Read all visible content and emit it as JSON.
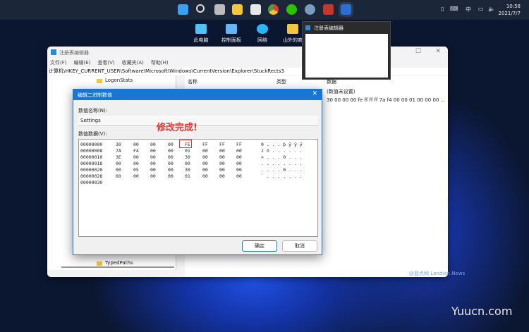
{
  "taskbar": {
    "icons": [
      "start-icon",
      "search-icon",
      "task-view-icon",
      "file-explorer-icon",
      "store-icon",
      "chrome-icon",
      "wechat-icon",
      "settings-icon",
      "app-icon",
      "regedit-icon"
    ],
    "tray": {
      "ime": "中",
      "time": "10:58",
      "date": "2021/7/7"
    }
  },
  "desktop": [
    {
      "label": "此电脑"
    },
    {
      "label": "控制面板"
    },
    {
      "label": "网络"
    },
    {
      "label": "山外的商"
    }
  ],
  "thumbnail": {
    "title": "注册表编辑器"
  },
  "window": {
    "title": "注册表编辑器",
    "menu": [
      "文件(F)",
      "编辑(E)",
      "查看(V)",
      "收藏夹(A)",
      "帮助(H)"
    ],
    "address": "计算机\\HKEY_CURRENT_USER\\Software\\Microsoft\\Windows\\CurrentVersion\\Explorer\\StuckRects3",
    "tree": [
      "LogonStats",
      "TypedPaths"
    ],
    "columns": [
      "名称",
      "类型",
      "数据"
    ],
    "values": [
      "(数值未设置)",
      "30 00 00 00 fe ff ff ff 7a f4 00 00 01 00 00 00 ..."
    ]
  },
  "dialog": {
    "title": "编辑二进制数值",
    "name_label": "数值名称(N):",
    "name_value": "Settings",
    "data_label": "数值数据(V):",
    "rows": [
      {
        "offset": "00000000",
        "bytes": [
          "30",
          "00",
          "00",
          "00",
          "FE",
          "FF",
          "FF",
          "FF"
        ],
        "ascii": "0 . . . þ ÿ ÿ ÿ"
      },
      {
        "offset": "00000008",
        "bytes": [
          "7A",
          "F4",
          "00",
          "00",
          "01",
          "00",
          "00",
          "00"
        ],
        "ascii": "z ô . . . . . ."
      },
      {
        "offset": "00000010",
        "bytes": [
          "3E",
          "00",
          "00",
          "00",
          "30",
          "00",
          "00",
          "00"
        ],
        "ascii": "> . . . 0 . . ."
      },
      {
        "offset": "00000018",
        "bytes": [
          "00",
          "00",
          "00",
          "00",
          "00",
          "00",
          "00",
          "00"
        ],
        "ascii": ". . . . . . . ."
      },
      {
        "offset": "00000020",
        "bytes": [
          "00",
          "05",
          "00",
          "00",
          "30",
          "00",
          "00",
          "00"
        ],
        "ascii": ". . . . 0 . . ."
      },
      {
        "offset": "00000028",
        "bytes": [
          "60",
          "00",
          "00",
          "00",
          "01",
          "00",
          "00",
          "00"
        ],
        "ascii": "` . . . . . . ."
      },
      {
        "offset": "00000030",
        "bytes": [],
        "ascii": ""
      }
    ],
    "ok": "确定",
    "cancel": "取消"
  },
  "annotation": "修改完成!",
  "watermarks": [
    "@蓝点网 Landian.News",
    "Yuucn.com"
  ],
  "colors": {
    "accent": "#1976d2",
    "annotation": "#e53935"
  }
}
